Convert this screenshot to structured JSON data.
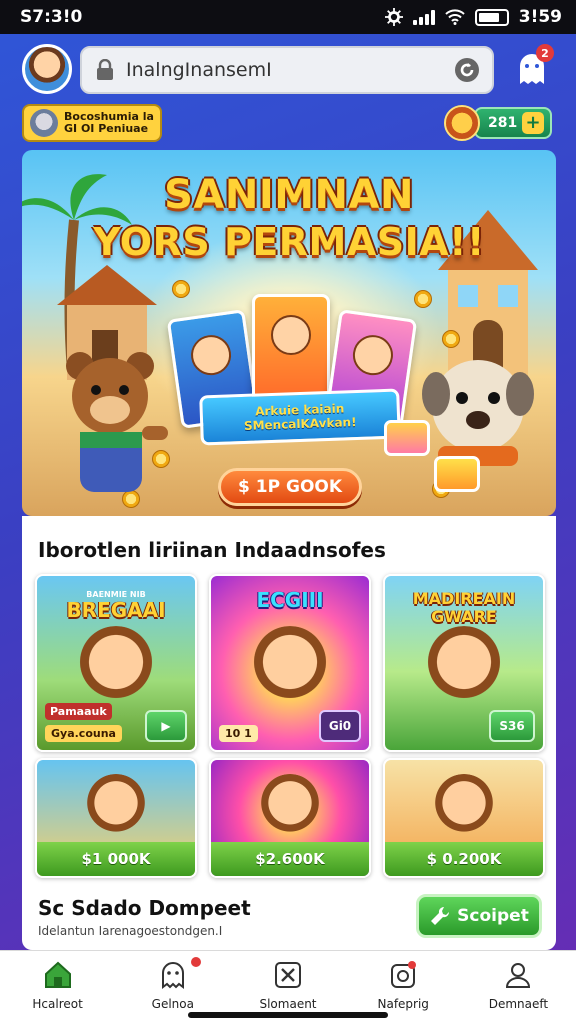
{
  "status_bar": {
    "time": "S7:3!0",
    "right_time": "3!59"
  },
  "header": {
    "url_text": "InalngInansemI",
    "notification_count": "2"
  },
  "user_chip": {
    "label_line1": "Bocoshumia la",
    "label_line2": "GI OI Peniuae"
  },
  "coins": {
    "value": "281",
    "plus": "+"
  },
  "hero": {
    "title_line1": "SANIMNAN",
    "title_line2": "YORS PERMASIA!!",
    "plate_line1": "Arkuie kaiain",
    "plate_line2": "SMencalKAvkan!",
    "cta_label": "1P GOOK",
    "cta_icon": "$"
  },
  "section": {
    "title": "Iborotlen liriinan Indaadnsofes"
  },
  "tiles": [
    {
      "title": "BREGAAI",
      "subtitle": "BAENMIE NIB",
      "tag": "Pamaauk",
      "tag2": "Gya.couna"
    },
    {
      "title": "ECGIII",
      "subtitle": "",
      "badge": "Gi0",
      "count": "10 1"
    },
    {
      "title": "MADIREAIN GWARE",
      "subtitle": "",
      "badge": "S36"
    },
    {
      "price": "$1 000K"
    },
    {
      "price": "$2.600K"
    },
    {
      "price": "$ 0.200K"
    }
  ],
  "footer": {
    "title": "Sc Sdado Dompeet",
    "subtitle": "Idelantun Iarenagoestondgen.I",
    "button_label": "Scoipet"
  },
  "nav": [
    {
      "label": "Hcalreot",
      "icon": "home-icon"
    },
    {
      "label": "Gelnoa",
      "icon": "ghost-icon"
    },
    {
      "label": "Slomaent",
      "icon": "crossed-box-icon"
    },
    {
      "label": "Nafeprig",
      "icon": "badge-icon"
    },
    {
      "label": "Demnaeft",
      "icon": "profile-icon"
    }
  ],
  "colors": {
    "brand_blue": "#2f57d8",
    "accent_orange": "#e24a12",
    "accent_green": "#3d9a1f",
    "title_yellow": "#ffd235"
  }
}
